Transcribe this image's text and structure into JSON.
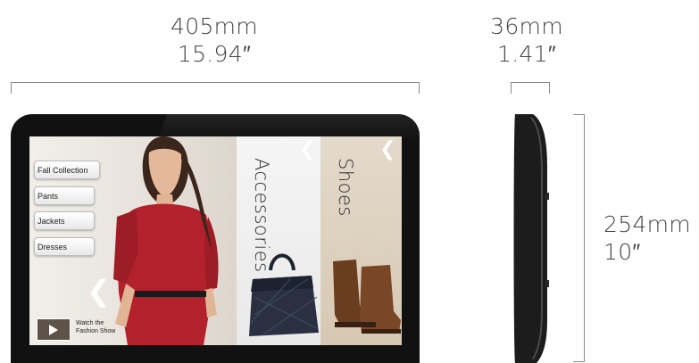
{
  "width_dim": {
    "metric": "405mm",
    "imperial": "15.94″"
  },
  "depth_dim": {
    "metric": "36mm",
    "imperial": "1.41″"
  },
  "height_dim": {
    "metric": "254mm",
    "imperial": "10″"
  },
  "menu": {
    "items": [
      "Fall Collection",
      "Pants",
      "Jackets",
      "Dresses"
    ]
  },
  "panels": {
    "accessories": "Accessories",
    "shoes": "Shoes"
  },
  "video": {
    "label_line1": "Watch the",
    "label_line2": "Fashion Show"
  },
  "colors": {
    "dress": "#b3222c",
    "bezel": "#111111",
    "text": "#444444"
  }
}
